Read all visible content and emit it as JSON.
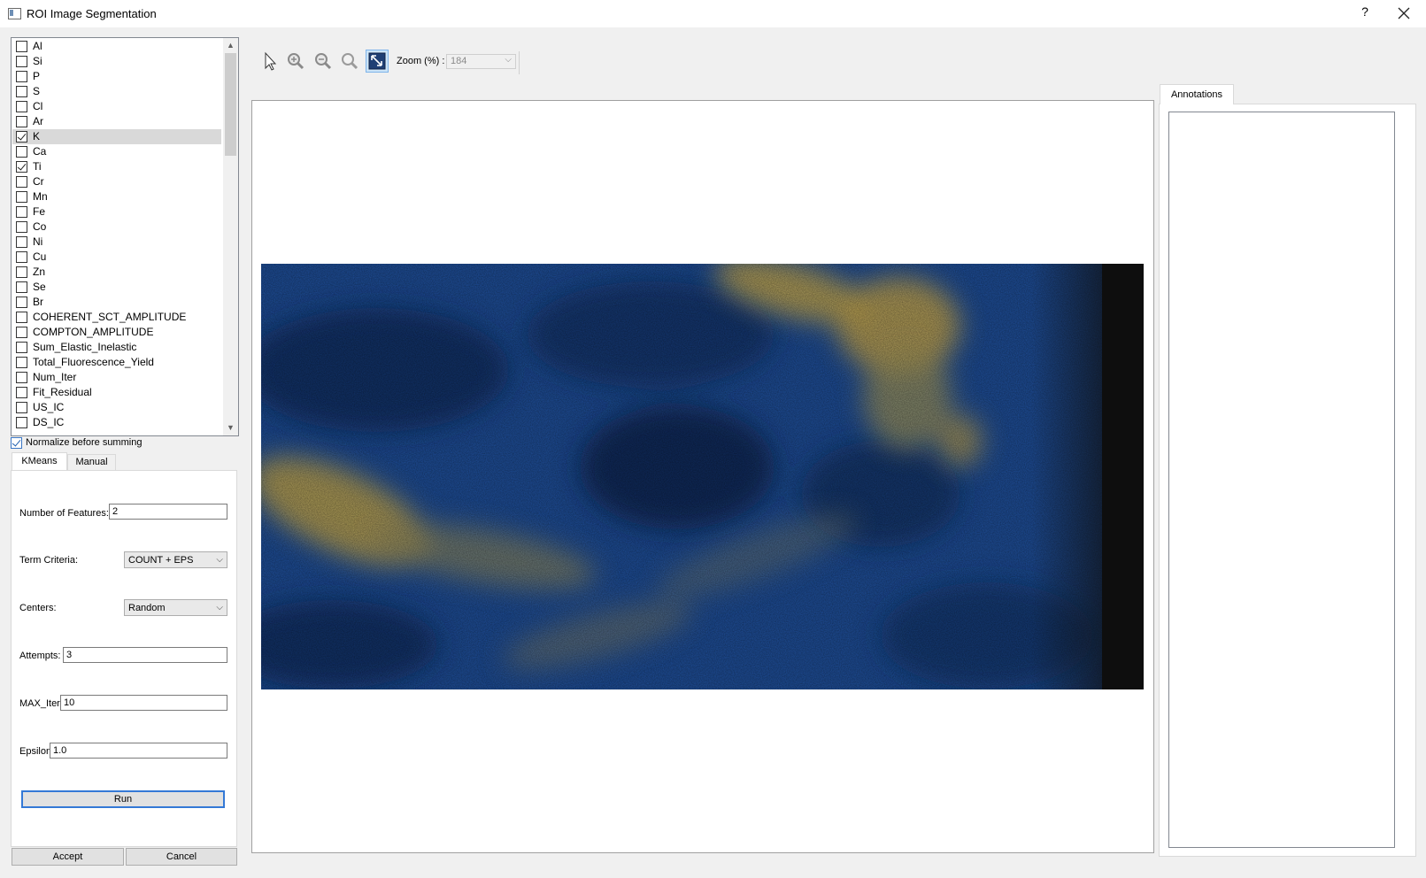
{
  "window": {
    "title": "ROI Image Segmentation",
    "help_label": "?"
  },
  "channels": [
    {
      "label": "Al",
      "checked": false
    },
    {
      "label": "Si",
      "checked": false
    },
    {
      "label": "P",
      "checked": false
    },
    {
      "label": "S",
      "checked": false
    },
    {
      "label": "Cl",
      "checked": false
    },
    {
      "label": "Ar",
      "checked": false
    },
    {
      "label": "K",
      "checked": true,
      "selected": true
    },
    {
      "label": "Ca",
      "checked": false
    },
    {
      "label": "Ti",
      "checked": true
    },
    {
      "label": "Cr",
      "checked": false
    },
    {
      "label": "Mn",
      "checked": false
    },
    {
      "label": "Fe",
      "checked": false
    },
    {
      "label": "Co",
      "checked": false
    },
    {
      "label": "Ni",
      "checked": false
    },
    {
      "label": "Cu",
      "checked": false
    },
    {
      "label": "Zn",
      "checked": false
    },
    {
      "label": "Se",
      "checked": false
    },
    {
      "label": "Br",
      "checked": false
    },
    {
      "label": "COHERENT_SCT_AMPLITUDE",
      "checked": false
    },
    {
      "label": "COMPTON_AMPLITUDE",
      "checked": false
    },
    {
      "label": "Sum_Elastic_Inelastic",
      "checked": false
    },
    {
      "label": "Total_Fluorescence_Yield",
      "checked": false
    },
    {
      "label": "Num_Iter",
      "checked": false
    },
    {
      "label": "Fit_Residual",
      "checked": false
    },
    {
      "label": "US_IC",
      "checked": false
    },
    {
      "label": "DS_IC",
      "checked": false
    }
  ],
  "normalize": {
    "label": "Normalize before summing",
    "checked": true
  },
  "tabs": {
    "kmeans": "KMeans",
    "manual": "Manual"
  },
  "kmeans": {
    "num_features_label": "Number of Features:",
    "num_features_value": "2",
    "term_criteria_label": "Term Criteria:",
    "term_criteria_value": "COUNT + EPS",
    "centers_label": "Centers:",
    "centers_value": "Random",
    "attempts_label": "Attempts:",
    "attempts_value": "3",
    "max_iter_label": "MAX_Iter",
    "max_iter_value": "10",
    "epsilon_label": "Epsilon",
    "epsilon_value": "1.0",
    "run_label": "Run"
  },
  "footer": {
    "accept_label": "Accept",
    "cancel_label": "Cancel"
  },
  "toolbar": {
    "tools": [
      "pointer-icon",
      "zoom-in-icon",
      "zoom-out-icon",
      "zoom-reset-icon",
      "fit-to-window-icon"
    ],
    "active_tool": "fit-to-window-icon",
    "zoom_label": "Zoom (%) :",
    "zoom_value": "184"
  },
  "annotations": {
    "tab_label": "Annotations"
  },
  "colors": {
    "map_low": "#0f1e3d",
    "map_mid": "#1f4f9a",
    "map_high": "#e3c24a",
    "map_edge": "#0e0e0e"
  }
}
